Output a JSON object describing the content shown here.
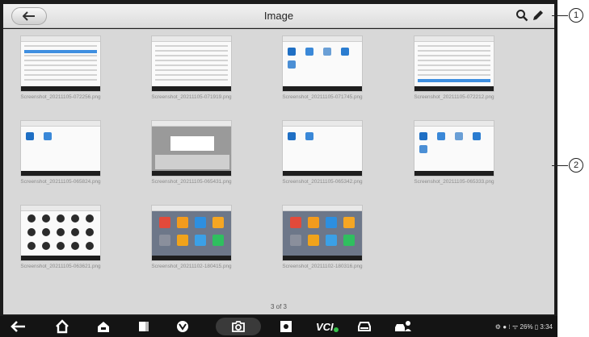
{
  "header": {
    "title": "Image"
  },
  "gallery": {
    "items": [
      {
        "filename": "Screenshot_20211105-072256.png"
      },
      {
        "filename": "Screenshot_20211105-071919.png"
      },
      {
        "filename": "Screenshot_20211105-071745.png"
      },
      {
        "filename": "Screenshot_20211105-072212.png"
      },
      {
        "filename": "Screenshot_20211105-065824.png"
      },
      {
        "filename": "Screenshot_20211105-065431.png"
      },
      {
        "filename": "Screenshot_20211105-065342.png"
      },
      {
        "filename": "Screenshot_20211105-065333.png"
      },
      {
        "filename": "Screenshot_20211105-063621.png"
      },
      {
        "filename": "Screenshot_20211102-180415.png"
      },
      {
        "filename": "Screenshot_20211102-180316.png"
      }
    ],
    "page_indicator": "3 of 3"
  },
  "status_bar": {
    "battery_text": "26%",
    "time": "3:34"
  },
  "callouts": {
    "first": "1",
    "second": "2"
  },
  "icons": [
    "back-arrow-icon",
    "search-icon",
    "edit-icon",
    "back-icon",
    "home-icon",
    "vehicle-home-icon",
    "recent-apps-icon",
    "browser-icon",
    "camera-icon",
    "display-icon",
    "vci-icon",
    "car-icon",
    "remote-icon"
  ]
}
